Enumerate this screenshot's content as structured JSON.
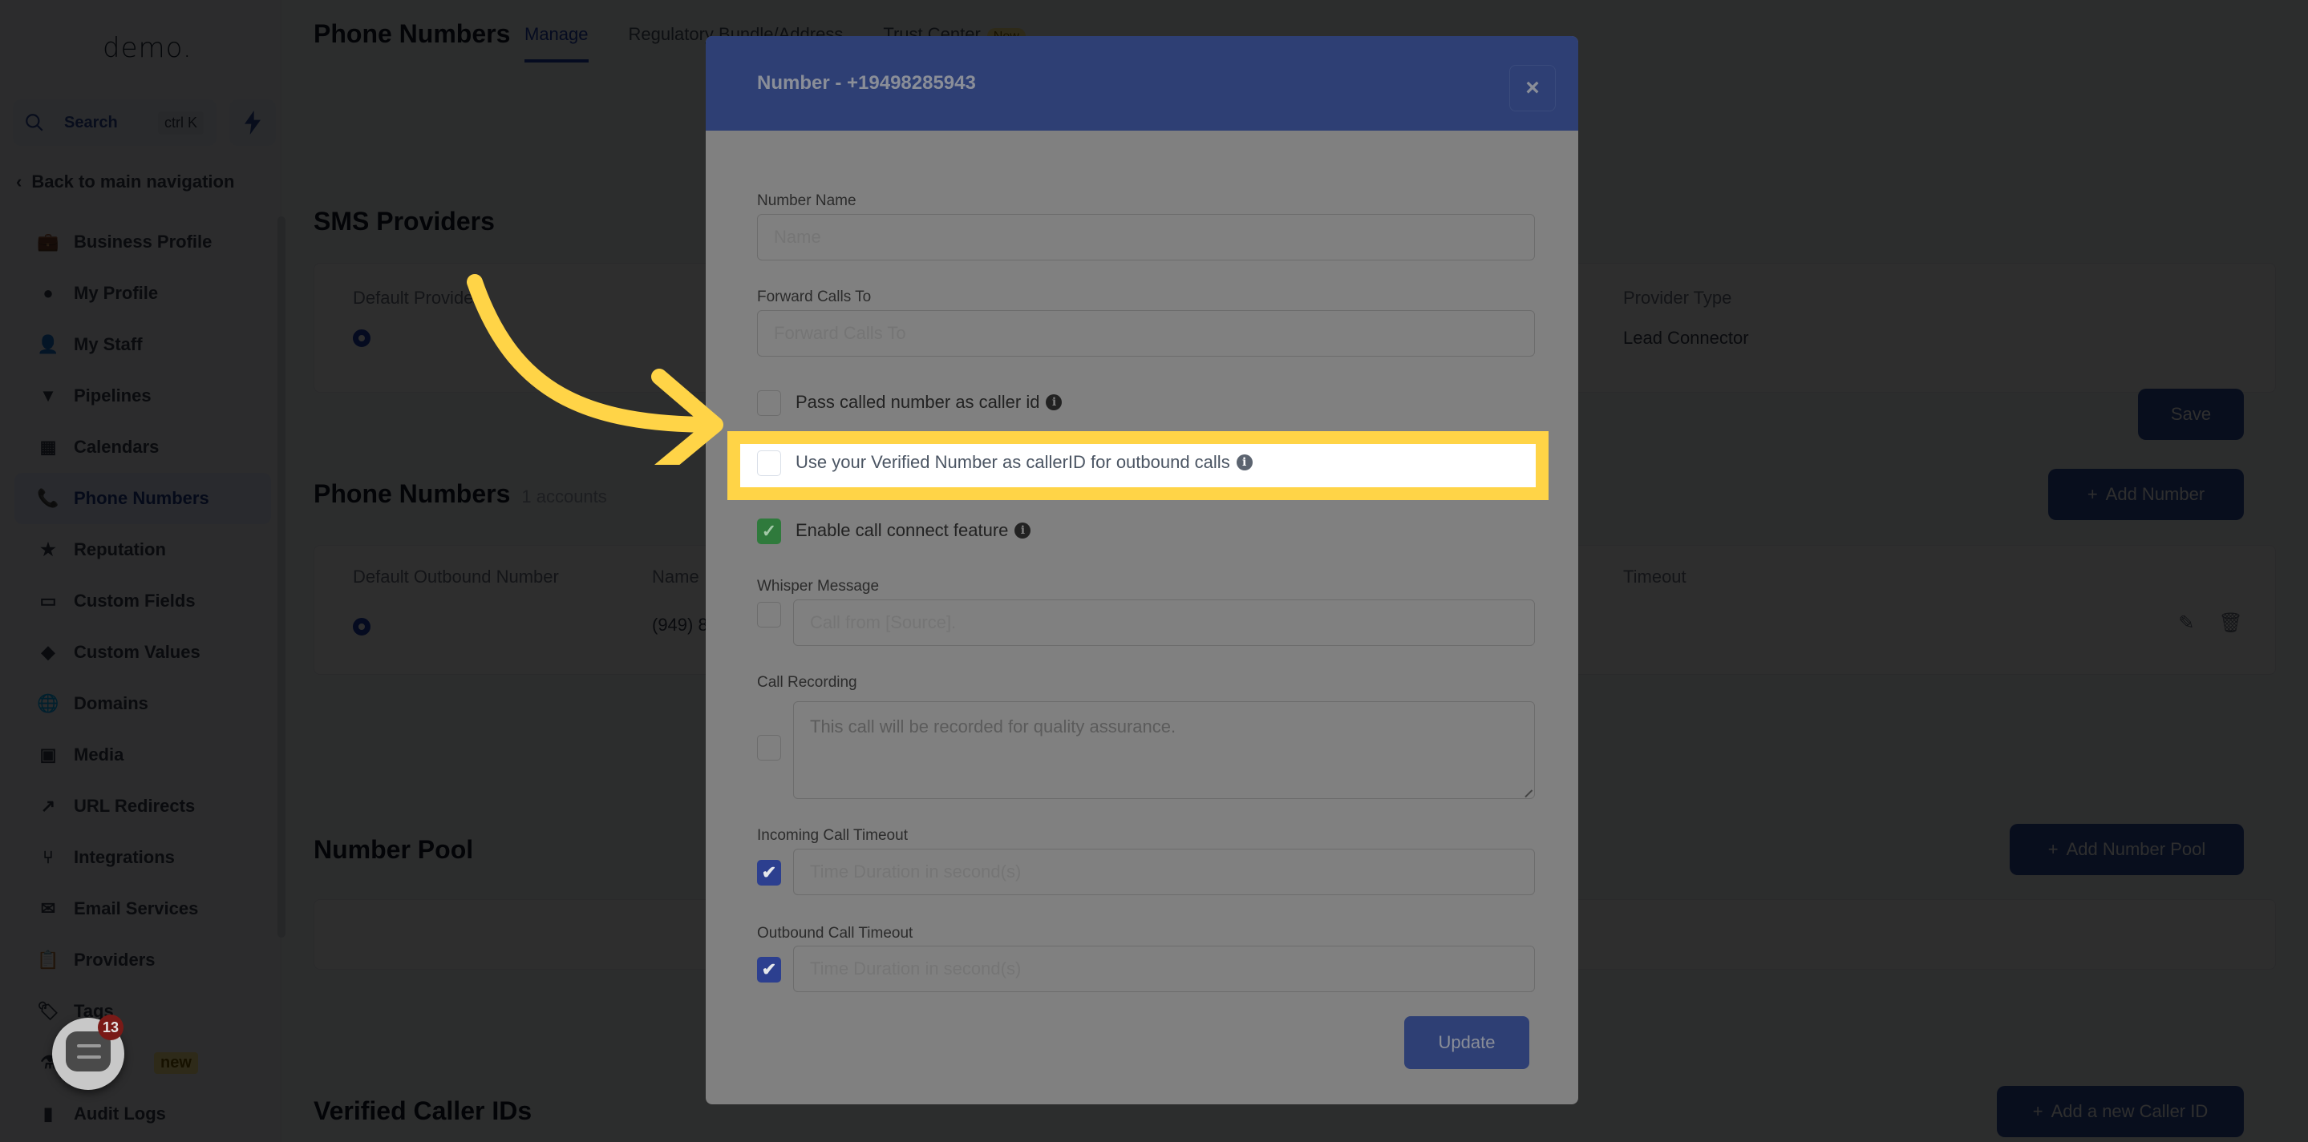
{
  "sidebar": {
    "logo": "demo.",
    "search": {
      "label": "Search",
      "shortcut": "ctrl K"
    },
    "back_label": "Back to main navigation",
    "items": [
      {
        "label": "Business Profile",
        "icon": "briefcase-icon",
        "active": false
      },
      {
        "label": "My Profile",
        "icon": "user-circle-icon",
        "active": false
      },
      {
        "label": "My Staff",
        "icon": "user-icon",
        "active": false
      },
      {
        "label": "Pipelines",
        "icon": "funnel-icon",
        "active": false
      },
      {
        "label": "Calendars",
        "icon": "calendar-icon",
        "active": false
      },
      {
        "label": "Phone Numbers",
        "icon": "phone-icon",
        "active": true
      },
      {
        "label": "Reputation",
        "icon": "star-icon",
        "active": false
      },
      {
        "label": "Custom Fields",
        "icon": "text-field-icon",
        "active": false
      },
      {
        "label": "Custom Values",
        "icon": "gem-icon",
        "active": false
      },
      {
        "label": "Domains",
        "icon": "globe-icon",
        "active": false
      },
      {
        "label": "Media",
        "icon": "media-icon",
        "active": false
      },
      {
        "label": "URL Redirects",
        "icon": "redirect-icon",
        "active": false
      },
      {
        "label": "Integrations",
        "icon": "integrations-icon",
        "active": false
      },
      {
        "label": "Email Services",
        "icon": "mail-icon",
        "active": false
      },
      {
        "label": "Providers",
        "icon": "clipboard-check-icon",
        "active": false
      },
      {
        "label": "Tags",
        "icon": "tag-icon",
        "active": false
      },
      {
        "label": "",
        "icon": "flask-icon",
        "badge": "new",
        "active": false
      },
      {
        "label": "Audit Logs",
        "icon": "bar-chart-icon",
        "active": false
      }
    ]
  },
  "chat_widget": {
    "badge_count": "13"
  },
  "header": {
    "title": "Phone Numbers",
    "tabs": [
      {
        "label": "Manage",
        "active": true
      },
      {
        "label": "Regulatory Bundle/Address",
        "active": false
      },
      {
        "label": "Trust Center",
        "badge": "New",
        "active": false
      }
    ]
  },
  "sms_providers": {
    "title": "SMS Providers",
    "columns": [
      "Default Provider",
      "Provider Type"
    ],
    "rows": [
      {
        "default": true,
        "provider_type": "Lead Connector"
      }
    ],
    "save_label": "Save"
  },
  "phone_numbers": {
    "title": "Phone Numbers",
    "count_label": "1 accounts",
    "add_label": "Add Number",
    "columns": [
      "Default Outbound Number",
      "Name",
      "Timeout"
    ],
    "rows": [
      {
        "default": true,
        "name": "(949) 8"
      }
    ]
  },
  "number_pool": {
    "title": "Number Pool",
    "add_label": "Add Number Pool"
  },
  "verified_caller_ids": {
    "title": "Verified Caller IDs",
    "add_label": "Add a new Caller ID"
  },
  "modal": {
    "title": "Number - +19498285943",
    "close_label": "×",
    "number_name": {
      "label": "Number Name",
      "placeholder": "Name",
      "value": ""
    },
    "forward_calls": {
      "label": "Forward Calls To",
      "placeholder": "Forward Calls To",
      "value": ""
    },
    "pass_called_number": {
      "label": "Pass called number as caller id",
      "checked": false
    },
    "use_verified_number": {
      "label": "Use your Verified Number as callerID for outbound calls",
      "checked": false
    },
    "enable_call_connect": {
      "label": "Enable call connect feature",
      "checked": true,
      "check_glyph": "✓"
    },
    "whisper_message": {
      "label": "Whisper Message",
      "placeholder": "Call from [Source].",
      "checked": false
    },
    "call_recording": {
      "label": "Call Recording",
      "placeholder": "This call will be recorded for quality assurance.",
      "checked": false
    },
    "incoming_timeout": {
      "label": "Incoming Call Timeout",
      "placeholder": "Time Duration in second(s)",
      "checked": true,
      "check_glyph": "✔"
    },
    "outbound_timeout": {
      "label": "Outbound Call Timeout",
      "placeholder": "Time Duration in second(s)",
      "checked": true,
      "check_glyph": "✔"
    },
    "update_label": "Update",
    "info_glyph": "i"
  },
  "annotation": {
    "highlight_color": "#ffd447",
    "arrow_color": "#ffd447"
  }
}
